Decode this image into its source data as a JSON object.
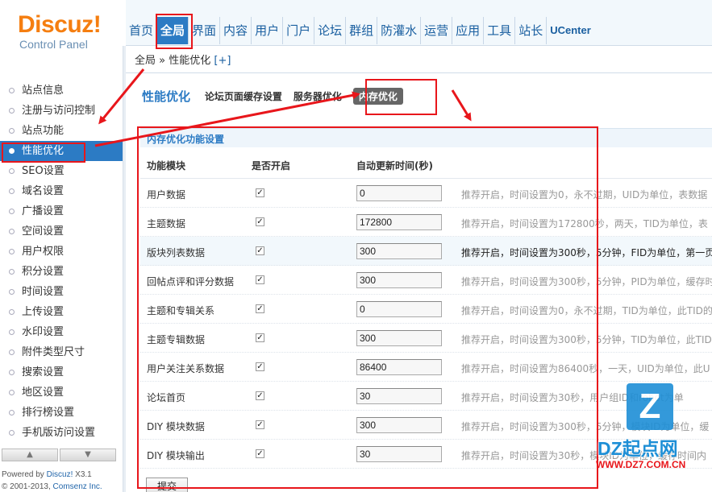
{
  "logo": {
    "brand": "Discuz",
    "bang": "!",
    "sub": "Control Panel"
  },
  "nav": {
    "items": [
      "首页",
      "全局",
      "界面",
      "内容",
      "用户",
      "门户",
      "论坛",
      "群组",
      "防灌水",
      "运营",
      "应用",
      "工具",
      "站长",
      "UCenter"
    ],
    "active": "全局"
  },
  "breadcrumb": {
    "parent": "全局",
    "sep": "»",
    "current": "性能优化",
    "plus": "[+]"
  },
  "sidebar": {
    "items": [
      "站点信息",
      "注册与访问控制",
      "站点功能",
      "性能优化",
      "SEO设置",
      "域名设置",
      "广播设置",
      "空间设置",
      "用户权限",
      "积分设置",
      "时间设置",
      "上传设置",
      "水印设置",
      "附件类型尺寸",
      "搜索设置",
      "地区设置",
      "排行榜设置",
      "手机版访问设置"
    ],
    "active": "性能优化",
    "scroll_up": "▲",
    "scroll_down": "▼"
  },
  "footer": {
    "powered_prefix": "Powered by ",
    "powered_brand": "Discuz!",
    "powered_version": " X3.1",
    "copyright_prefix": "© 2001-2013, ",
    "copyright_brand": "Comsenz Inc."
  },
  "page": {
    "title": "性能优化",
    "tabs": [
      "论坛页面缓存设置",
      "服务器优化",
      "内存优化"
    ],
    "active_tab": "内存优化"
  },
  "section": {
    "title": "内存优化功能设置",
    "headers": {
      "module": "功能模块",
      "enabled": "是否开启",
      "ttl": "自动更新时间(秒)"
    },
    "rows": [
      {
        "name": "用户数据",
        "checked": "✓",
        "ttl": "0",
        "tip": "推荐开启，时间设置为0，永不过期，UID为单位，表数据",
        "hl": false
      },
      {
        "name": "主题数据",
        "checked": "✓",
        "ttl": "172800",
        "tip": "推荐开启，时间设置为172800秒，两天，TID为单位，表",
        "hl": false
      },
      {
        "name": "版块列表数据",
        "checked": "✓",
        "ttl": "300",
        "tip": "推荐开启，时间设置为300秒，5分钟，FID为单位，第一页",
        "hl": true
      },
      {
        "name": "回帖点评和评分数据",
        "checked": "✓",
        "ttl": "300",
        "tip": "推荐开启，时间设置为300秒，5分钟，PID为单位，缓存时",
        "hl": false
      },
      {
        "name": "主题和专辑关系",
        "checked": "✓",
        "ttl": "0",
        "tip": "推荐开启，时间设置为0，永不过期，TID为单位，此TID的",
        "hl": false
      },
      {
        "name": "主题专辑数据",
        "checked": "✓",
        "ttl": "300",
        "tip": "推荐开启，时间设置为300秒，5分钟，TID为单位，此TID",
        "hl": false
      },
      {
        "name": "用户关注关系数据",
        "checked": "✓",
        "ttl": "86400",
        "tip": "推荐开启，时间设置为86400秒，一天，UID为单位，此U",
        "hl": false
      },
      {
        "name": "论坛首页",
        "checked": "✓",
        "ttl": "30",
        "tip": "推荐开启，时间设置为30秒，用户组ID和robot为单",
        "hl": false
      },
      {
        "name": "DIY 模块数据",
        "checked": "✓",
        "ttl": "300",
        "tip": "推荐开启，时间设置为300秒，5分钟，模块ID为单位，缓",
        "hl": false
      },
      {
        "name": "DIY 模块输出",
        "checked": "✓",
        "ttl": "30",
        "tip": "推荐开启，时间设置为30秒，模块ID为单位，缓存时间内",
        "hl": false
      }
    ],
    "submit": "提交"
  },
  "watermark": {
    "mark": "Z",
    "name": "DZ起点网",
    "url": "WWW.DZ7.COM.CN"
  },
  "colors": {
    "accent": "#2c7bc4",
    "annotation": "#e8161b",
    "logo": "#f57e10"
  }
}
